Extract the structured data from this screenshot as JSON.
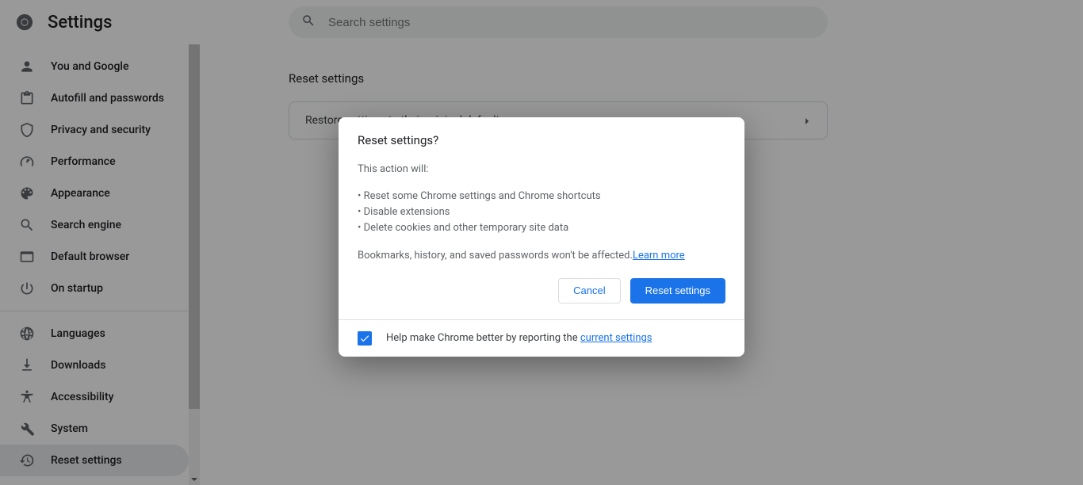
{
  "app_title": "Settings",
  "search": {
    "placeholder": "Search settings"
  },
  "sidebar": {
    "items": [
      {
        "label": "You and Google"
      },
      {
        "label": "Autofill and passwords"
      },
      {
        "label": "Privacy and security"
      },
      {
        "label": "Performance"
      },
      {
        "label": "Appearance"
      },
      {
        "label": "Search engine"
      },
      {
        "label": "Default browser"
      },
      {
        "label": "On startup"
      }
    ],
    "items2": [
      {
        "label": "Languages"
      },
      {
        "label": "Downloads"
      },
      {
        "label": "Accessibility"
      },
      {
        "label": "System"
      },
      {
        "label": "Reset settings"
      }
    ]
  },
  "section": {
    "title": "Reset settings",
    "row_label": "Restore settings to their original defaults"
  },
  "dialog": {
    "title": "Reset settings?",
    "intro": "This action will:",
    "bullets": [
      "Reset some Chrome settings and Chrome shortcuts",
      "Disable extensions",
      "Delete cookies and other temporary site data"
    ],
    "footnote_pre": "Bookmarks, history, and saved passwords won't be affected.",
    "learn_more": "Learn more",
    "cancel": "Cancel",
    "confirm": "Reset settings",
    "checkbox_checked": true,
    "footer_text_pre": "Help make Chrome better by reporting the ",
    "footer_link": "current settings"
  }
}
